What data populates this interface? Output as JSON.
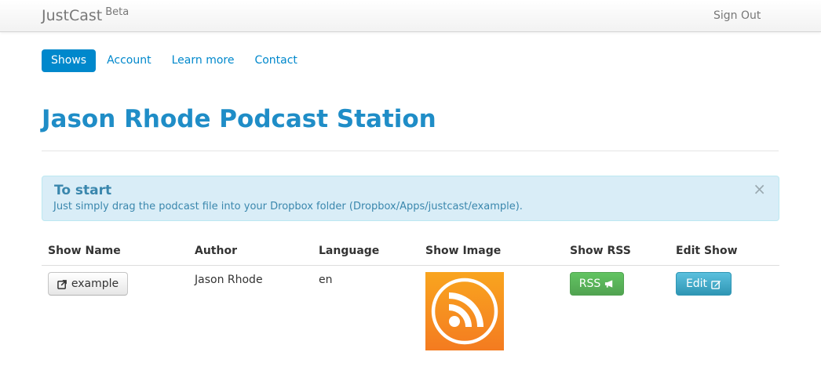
{
  "navbar": {
    "brand": "JustCast",
    "brand_badge": "Beta",
    "signout_label": "Sign Out"
  },
  "nav": {
    "tabs": [
      {
        "label": "Shows",
        "active": true
      },
      {
        "label": "Account"
      },
      {
        "label": "Learn more"
      },
      {
        "label": "Contact"
      }
    ]
  },
  "page": {
    "title": "Jason Rhode Podcast Station"
  },
  "alert": {
    "title": "To start",
    "text": "Just simply drag the podcast file into your Dropbox folder (Dropbox/Apps/justcast/example).",
    "close_symbol": "×"
  },
  "table": {
    "headers": [
      "Show Name",
      "Author",
      "Language",
      "Show Image",
      "Show RSS",
      "Edit Show"
    ],
    "rows": [
      {
        "show_name": "example",
        "author": "Jason Rhode",
        "language": "en",
        "image_icon": "rss-feed-icon",
        "rss_label": "RSS",
        "edit_label": "Edit"
      }
    ]
  },
  "colors": {
    "primary": "#0088cc",
    "title": "#1f8dc7",
    "success": "#51a351",
    "info": "#2f96b4",
    "alert_bg": "#d9edf7",
    "rss_orange": "#f7941d"
  }
}
